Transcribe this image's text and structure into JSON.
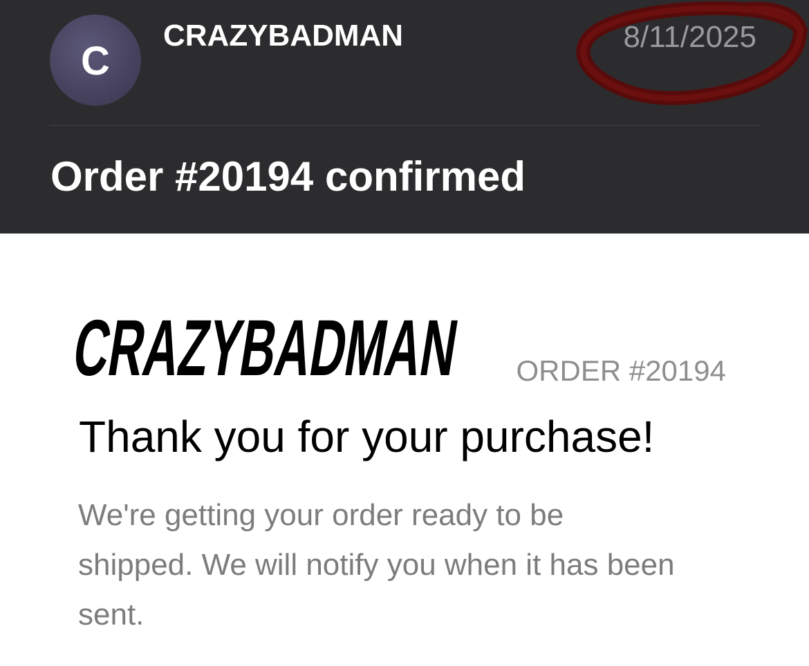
{
  "header": {
    "avatar_letter": "C",
    "sender": "CRAZYBADMAN",
    "date": "8/11/2025",
    "subject": "Order #20194 confirmed"
  },
  "body": {
    "logo_text": "CRAZYBADMAN",
    "order_number": "ORDER #20194",
    "heading": "Thank you for your purchase!",
    "message": "We're getting your order ready to be shipped. We will notify you when it has been sent."
  },
  "colors": {
    "header_bg": "#2c2c2e",
    "avatar_bg": "#46425e",
    "date_text": "#9a9a9e",
    "annotation_red": "#6e0d0d",
    "body_bg": "#ffffff",
    "muted_text": "#7c7c7c"
  },
  "icons": {
    "annotation": "hand-drawn-red-circle"
  }
}
